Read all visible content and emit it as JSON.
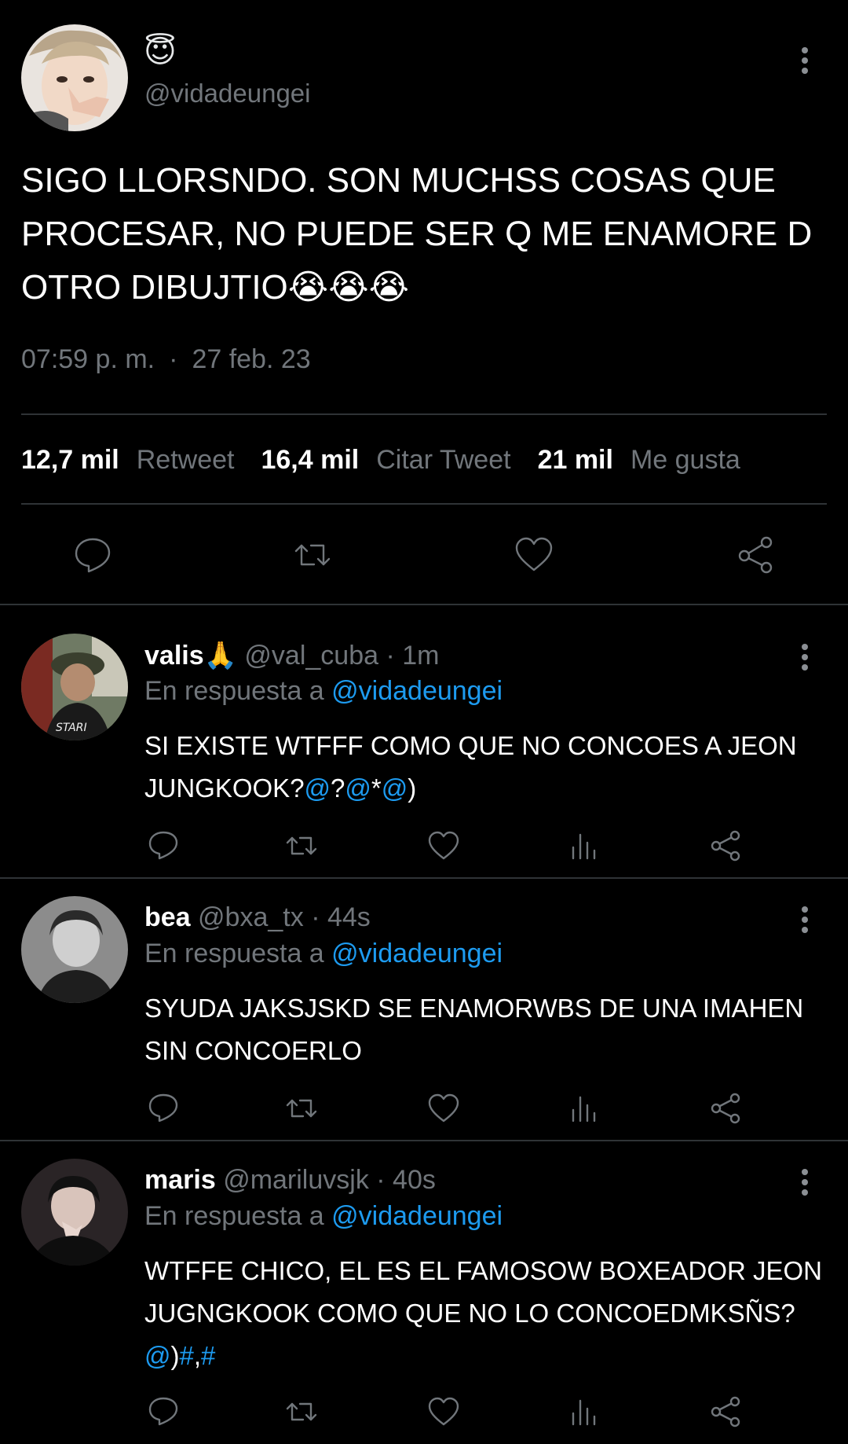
{
  "main_tweet": {
    "badge_emoji": "😇",
    "handle": "@vidadeungei",
    "text": "SIGO LLORSNDO. SON MUCHSS COSAS QUE PROCESAR, NO PUEDE SER Q ME ENAMORE D OTRO DIBUJTIO😭😭😭",
    "time": "07:59 p. m.",
    "separator": "·",
    "date": "27 feb. 23",
    "stats": [
      {
        "value": "12,7 mil",
        "label": "Retweet"
      },
      {
        "value": "16,4 mil",
        "label": "Citar Tweet"
      },
      {
        "value": "21 mil",
        "label": "Me gusta"
      }
    ]
  },
  "replies": [
    {
      "name": "valis🙏",
      "handle": "@val_cuba",
      "time": "· 1m",
      "reply_prefix": "En respuesta a",
      "reply_to": "@vidadeungei",
      "text_parts": [
        {
          "t": "SI EXISTE WTFFF COMO QUE NO CONCOES A JEON JUNGKOOK?",
          "c": "w"
        },
        {
          "t": "@",
          "c": "b"
        },
        {
          "t": "?",
          "c": "w"
        },
        {
          "t": "@",
          "c": "b"
        },
        {
          "t": "*",
          "c": "w"
        },
        {
          "t": "@",
          "c": "b"
        },
        {
          "t": ")",
          "c": "w"
        }
      ]
    },
    {
      "name": "bea",
      "handle": "@bxa_tx",
      "time": "· 44s",
      "reply_prefix": "En respuesta a",
      "reply_to": "@vidadeungei",
      "text_parts": [
        {
          "t": "SYUDA JAKSJSKD SE ENAMORWBS DE UNA IMAHEN SIN CONCOERLO",
          "c": "w"
        }
      ]
    },
    {
      "name": "maris",
      "handle": "@mariluvsjk",
      "time": "· 40s",
      "reply_prefix": "En respuesta a",
      "reply_to": "@vidadeungei",
      "text_parts": [
        {
          "t": "WTFFE CHICO, EL ES EL FAMOSOW BOXEADOR JEON JUGNGKOOK COMO QUE NO LO CONCOEDMKSÑS? ",
          "c": "w"
        },
        {
          "t": "@",
          "c": "b"
        },
        {
          "t": ")",
          "c": "w"
        },
        {
          "t": "#",
          "c": "b"
        },
        {
          "t": ",",
          "c": "w"
        },
        {
          "t": "#",
          "c": "b"
        }
      ]
    }
  ],
  "colors": {
    "background": "#000000",
    "text": "#ffffff",
    "secondary": "#71767b",
    "link": "#1d9bf0",
    "divider": "#2f3336"
  },
  "icons": [
    "reply-icon",
    "retweet-icon",
    "like-icon",
    "share-icon",
    "views-icon",
    "more-icon"
  ]
}
